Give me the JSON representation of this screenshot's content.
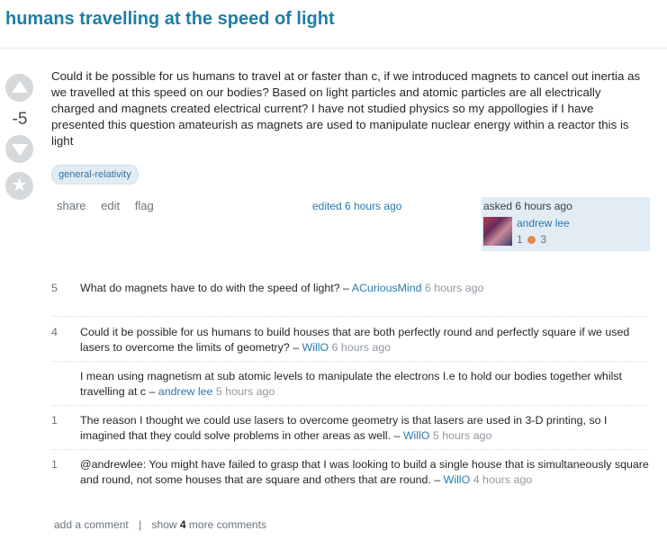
{
  "question": {
    "title": "humans travelling at the speed of light",
    "score": "-5",
    "body": "Could it be possible for us humans to travel at or faster than c, if we introduced magnets to cancel out inertia as we travelled at this speed on our bodies? Based on light particles and atomic particles are all electrically charged and magnets created electrical current? I have not studied physics so my appollogies if I have presented this question amateurish as magnets are used to manipulate nuclear energy within a reactor this is light",
    "tags": [
      "general-relativity"
    ],
    "menu": {
      "share": "share",
      "edit": "edit",
      "flag": "flag"
    },
    "edited": "edited 6 hours ago",
    "owner": {
      "asked": "asked 6 hours ago",
      "name": "andrew lee",
      "reputation": "1",
      "bronze_badges": "3",
      "bronze_color": "#e08a4c"
    }
  },
  "comments": [
    {
      "score": "5",
      "text": "What do magnets have to do with the speed of light? –",
      "user": "ACuriousMind",
      "time": "6 hours ago"
    },
    {
      "score": "4",
      "text": "Could it be possible for us humans to build houses that are both perfectly round and perfectly square if we used lasers to overcome the limits of geometry? –",
      "user": "WillO",
      "time": "6 hours ago"
    },
    {
      "score": "",
      "text": "I mean using magnetism at sub atomic levels to manipulate the electrons I.e to hold our bodies together whilst travelling at c –",
      "user": "andrew lee",
      "time": "5 hours ago"
    },
    {
      "score": "1",
      "text": "The reason I thought we could use lasers to overcome geometry is that lasers are used in 3-D printing, so I imagined that they could solve problems in other areas as well. –",
      "user": "WillO",
      "time": "5 hours ago"
    },
    {
      "score": "1",
      "text": "@andrewlee: You might have failed to grasp that I was looking to build a single house that is simultaneously square and round, not some houses that are square and others that are round. –",
      "user": "WillO",
      "time": "4 hours ago"
    }
  ],
  "comment_actions": {
    "add": "add a comment",
    "separator": "|",
    "show_prefix": "show",
    "show_count": "4",
    "show_suffix": "more comments"
  }
}
